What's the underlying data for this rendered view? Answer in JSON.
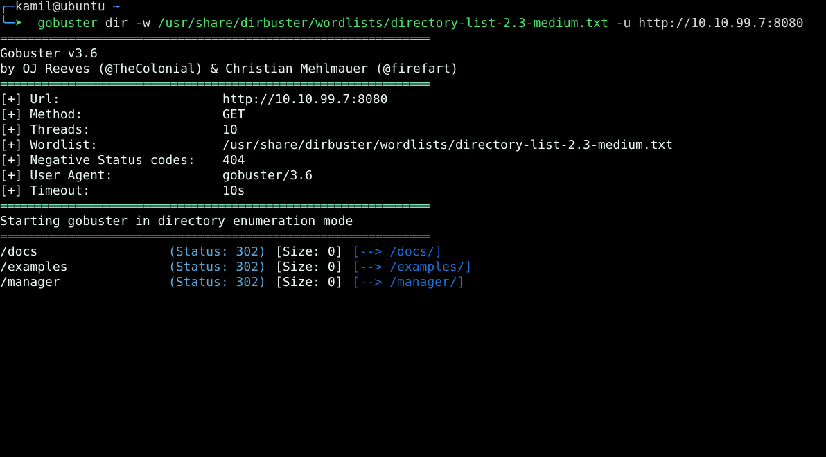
{
  "prompt": {
    "corner_top": "╭─",
    "corner_bottom": "╰─",
    "arrow": "➤",
    "user_host": "kamil@ubuntu",
    "cwd": "~"
  },
  "command": {
    "binary": "gobuster",
    "args1": "dir -w",
    "wordlist_path": "/usr/share/dirbuster/wordlists/directory-list-2.3-medium.txt",
    "args2": "-u http://10.10.99.7:8080"
  },
  "separator": "===============================================================",
  "banner": {
    "title": "Gobuster v3.6",
    "authors": "by OJ Reeves (@TheColonial) & Christian Mehlmauer (@firefart)"
  },
  "config": [
    {
      "label": "[+] Url:",
      "value": "http://10.10.99.7:8080"
    },
    {
      "label": "[+] Method:",
      "value": "GET"
    },
    {
      "label": "[+] Threads:",
      "value": "10"
    },
    {
      "label": "[+] Wordlist:",
      "value": "/usr/share/dirbuster/wordlists/directory-list-2.3-medium.txt"
    },
    {
      "label": "[+] Negative Status codes:",
      "value": "404"
    },
    {
      "label": "[+] User Agent:",
      "value": "gobuster/3.6"
    },
    {
      "label": "[+] Timeout:",
      "value": "10s"
    }
  ],
  "mode_line": "Starting gobuster in directory enumeration mode",
  "results": [
    {
      "path": "/docs",
      "status": "(Status: 302)",
      "size": "[Size: 0]",
      "redirect": "[--> /docs/]"
    },
    {
      "path": "/examples",
      "status": "(Status: 302)",
      "size": "[Size: 0]",
      "redirect": "[--> /examples/]"
    },
    {
      "path": "/manager",
      "status": "(Status: 302)",
      "size": "[Size: 0]",
      "redirect": "[--> /manager/]"
    }
  ],
  "colors": {
    "background": "#000000",
    "green": "#49e36a",
    "blue": "#4aa6ff",
    "status_blue": "#5aa6d6",
    "redirect_blue": "#1f6fd6",
    "text": "#e9f7f2"
  }
}
